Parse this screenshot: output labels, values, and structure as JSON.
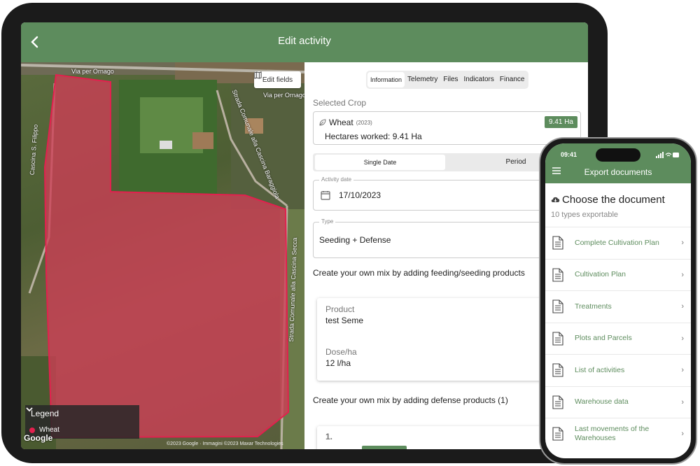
{
  "tablet": {
    "header": {
      "title": "Edit activity"
    },
    "map": {
      "edit_fields_label": "Edit fields",
      "roads": [
        "Via per Ornago",
        "Via per Ornago",
        "Cascina S. Filippo",
        "Strada Comunale alla Cascina Baraggiola",
        "Strada Comunale alla Cascina Secca"
      ],
      "legend": {
        "title": "Legend",
        "items": [
          {
            "label": "Wheat",
            "color": "#e3204e"
          }
        ]
      },
      "google_label": "Google",
      "copyright": "©2023 Google · Immagini ©2023 Maxar Technologies"
    },
    "panel": {
      "tabs": [
        "Information",
        "Telemetry",
        "Files",
        "Indicators",
        "Finance"
      ],
      "active_tab": "Information",
      "selected_crop_label": "Selected Crop",
      "crop": {
        "name": "Wheat",
        "year": "(2023)",
        "hectares_badge": "9.41 Ha",
        "hectares_worked": "Hectares worked: 9.41 Ha"
      },
      "date_mode": {
        "single": "Single Date",
        "period": "Period"
      },
      "activity_date": {
        "legend": "Activity date",
        "value": "17/10/2023"
      },
      "type": {
        "legend": "Type",
        "value": "Seeding + Defense"
      },
      "mix_feeding_text": "Create your own mix by adding feeding/seeding products",
      "product": {
        "product_key": "Product",
        "product_value": "test Seme",
        "dose_key": "Dose/ha",
        "dose_value": "12 l/ha"
      },
      "mix_defense_text": "Create your own mix by adding defense products (1)",
      "defense_item_number": "1."
    }
  },
  "phone": {
    "status": {
      "time": "09:41"
    },
    "header": {
      "title": "Export documents"
    },
    "heading": "Choose the document",
    "subheading": "10 types exportable",
    "documents": [
      "Complete Cultivation Plan",
      "Cultivation Plan",
      "Treatments",
      "Plots and Parcels",
      "List of activities",
      "Warehouse data",
      "Last movements of the Warehouses"
    ]
  },
  "colors": {
    "brand_green": "#5d8c5d",
    "field_red": "#e3204e"
  }
}
